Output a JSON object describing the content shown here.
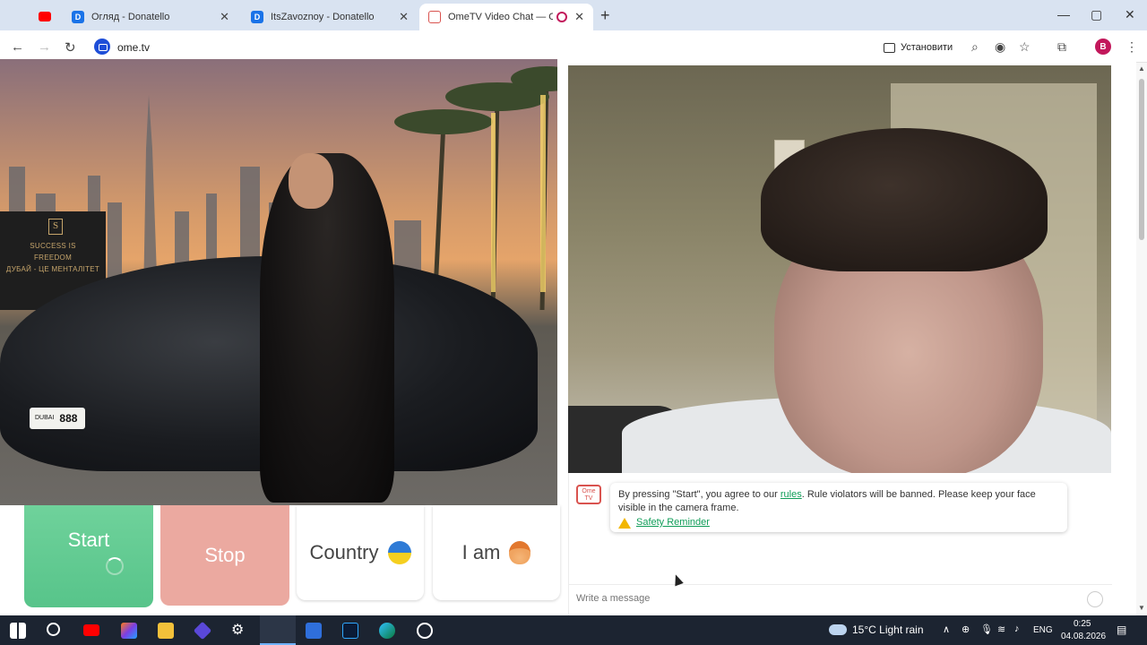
{
  "browser": {
    "tabs": [
      {
        "title": "Огляд - Donatello",
        "favicon": "D",
        "active": false
      },
      {
        "title": "ItsZavoznoy - Donatello",
        "favicon": "D",
        "active": false
      },
      {
        "title": "OmeTV Video Chat — Ome",
        "favicon": "tv",
        "active": true
      }
    ],
    "url": "ome.tv",
    "install_label": "Установити",
    "profile_initial": "B"
  },
  "left_video": {
    "sign_lines": [
      "SUCCESS IS",
      "FREEDOM",
      "ДУБАЙ - ЦЕ МЕНТАЛІТЕТ"
    ],
    "sign_logo": "S",
    "plate_number": "888",
    "plate_small": "DUBAI"
  },
  "controls": {
    "start_label": "Start",
    "stop_label": "Stop",
    "country_label": "Country",
    "iam_label": "I am"
  },
  "chat": {
    "sys_logo": "Ome TV",
    "notice_prefix": "By pressing \"Start\", you agree to our ",
    "notice_link": "rules",
    "notice_suffix": ". Rule violators will be banned. Please keep your face visible in the camera frame.",
    "safety_link": "Safety Reminder",
    "input_placeholder": "Write a message"
  },
  "taskbar": {
    "weather": "15°C  Light rain",
    "lang": "ENG",
    "time": "0:25",
    "date": "04.08.2026"
  }
}
